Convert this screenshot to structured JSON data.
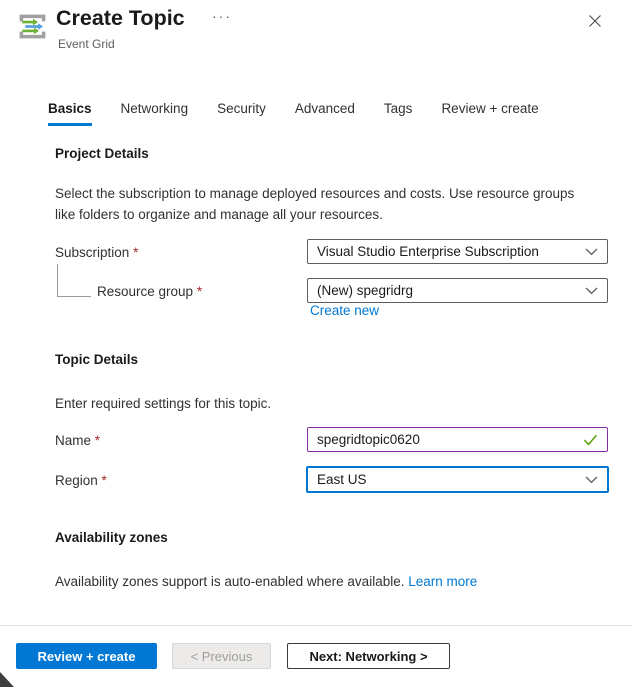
{
  "header": {
    "title": "Create Topic",
    "subtitle": "Event Grid",
    "more_label": "···"
  },
  "tabs": [
    {
      "label": "Basics",
      "active": true
    },
    {
      "label": "Networking",
      "active": false
    },
    {
      "label": "Security",
      "active": false
    },
    {
      "label": "Advanced",
      "active": false
    },
    {
      "label": "Tags",
      "active": false
    },
    {
      "label": "Review + create",
      "active": false
    }
  ],
  "sections": {
    "project_details": {
      "heading": "Project Details",
      "description": "Select the subscription to manage deployed resources and costs. Use resource groups like folders to organize and manage all your resources."
    },
    "topic_details": {
      "heading": "Topic Details",
      "description": "Enter required settings for this topic."
    },
    "availability_zones": {
      "heading": "Availability zones",
      "description": "Availability zones support is auto-enabled where available.",
      "link_label": "Learn more"
    }
  },
  "fields": {
    "subscription": {
      "label": "Subscription",
      "required": "*",
      "value": "Visual Studio Enterprise Subscription"
    },
    "resource_group": {
      "label": "Resource group",
      "required": "*",
      "value": "(New) spegridrg",
      "link_label": "Create new"
    },
    "name": {
      "label": "Name",
      "required": "*",
      "value": "spegridtopic0620",
      "valid": true
    },
    "region": {
      "label": "Region",
      "required": "*",
      "value": "East US"
    }
  },
  "footer": {
    "review_create_label": "Review + create",
    "previous_label": "< Previous",
    "next_label": "Next: Networking >"
  },
  "colors": {
    "accent": "#0078d4",
    "dirty_field_border": "#8a2da5",
    "validation_green": "#57a300",
    "required_red": "#a4262c",
    "icon_green": "#6cb133",
    "icon_blue": "#55a0dc",
    "icon_gray": "#a0a0a0"
  }
}
